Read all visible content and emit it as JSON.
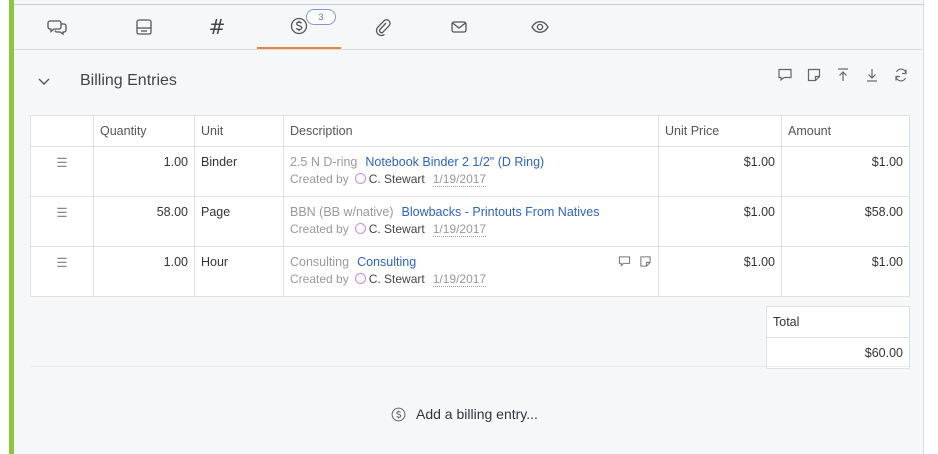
{
  "tabs": [
    {
      "icon": "comments-icon"
    },
    {
      "icon": "form-icon"
    },
    {
      "icon": "hash-icon",
      "text": "#"
    },
    {
      "icon": "billing-icon",
      "badge": "3",
      "active": true
    },
    {
      "icon": "paperclip-icon"
    },
    {
      "icon": "mail-icon"
    },
    {
      "icon": "eye-icon"
    }
  ],
  "section": {
    "title": "Billing Entries",
    "actions": [
      "comment-icon",
      "note-icon",
      "upload-icon",
      "download-icon",
      "refresh-icon"
    ]
  },
  "table": {
    "columns": [
      "",
      "Quantity",
      "Unit",
      "Description",
      "Unit Price",
      "Amount"
    ],
    "rows": [
      {
        "quantity": "1.00",
        "unit": "Binder",
        "code": "2.5 N D-ring",
        "item": "Notebook Binder 2 1/2\" (D Ring)",
        "created_by_label": "Created by",
        "user": "C. Stewart",
        "date": "1/19/2017",
        "unit_price": "$1.00",
        "amount": "$1.00"
      },
      {
        "quantity": "58.00",
        "unit": "Page",
        "code": "BBN (BB w/native)",
        "item": "Blowbacks - Printouts From Natives",
        "created_by_label": "Created by",
        "user": "C. Stewart",
        "date": "1/19/2017",
        "unit_price": "$1.00",
        "amount": "$58.00"
      },
      {
        "quantity": "1.00",
        "unit": "Hour",
        "code": "Consulting",
        "item": "Consulting",
        "created_by_label": "Created by",
        "user": "C. Stewart",
        "date": "1/19/2017",
        "unit_price": "$1.00",
        "amount": "$1.00"
      }
    ]
  },
  "total": {
    "label": "Total",
    "value": "$60.00"
  },
  "add_entry": {
    "label": "Add a billing entry..."
  },
  "colors": {
    "accent": "#8cc63f",
    "active_tab": "#e8833a",
    "link": "#2f64b4"
  }
}
